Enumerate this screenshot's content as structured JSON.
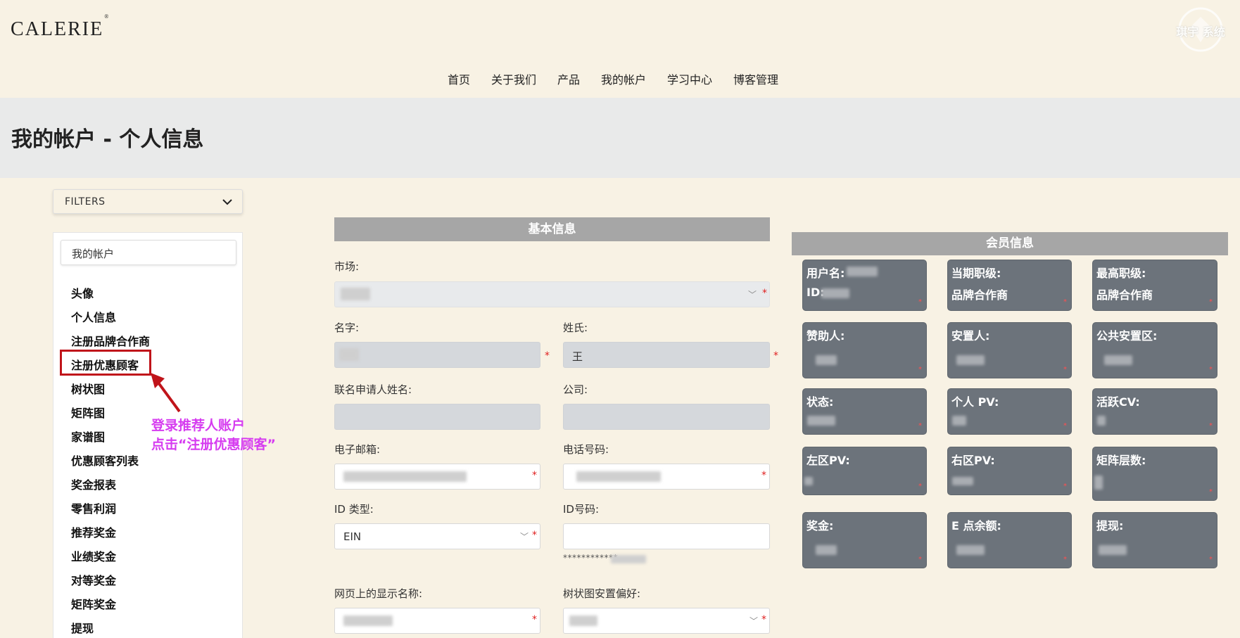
{
  "header": {
    "logo": "CALERIE",
    "logo_mark": "®",
    "watermark_text": "琪宇 系统"
  },
  "nav": [
    "首页",
    "关于我们",
    "产品",
    "我的帐户",
    "学习中心",
    "博客管理"
  ],
  "page_title": "我的帐户 - 个人信息",
  "sidebar": {
    "filters_label": "FILTERS",
    "account_label": "我的帐户",
    "items": [
      "头像",
      "个人信息",
      "注册品牌合作商",
      "注册优惠顾客",
      "树状图",
      "矩阵图",
      "家谱图",
      "优惠顾客列表",
      "奖金报表",
      "零售利润",
      "推荐奖金",
      "业绩奖金",
      "对等奖金",
      "矩阵奖金",
      "提现"
    ],
    "highlighted_item": "注册优惠顾客"
  },
  "annotation": {
    "line1": "登录推荐人账户",
    "line2": "点击“注册优惠顾客”"
  },
  "basic_info": {
    "heading": "基本信息",
    "market_label": "市场:",
    "first_name_label": "名字:",
    "last_name_label": "姓氏:",
    "last_name_value": "王",
    "co_applicant_label": "联名申请人姓名:",
    "company_label": "公司:",
    "email_label": "电子邮箱:",
    "phone_label": "电话号码:",
    "id_type_label": "ID 类型:",
    "id_type_value": "EIN",
    "id_number_label": "ID号码:",
    "id_number_masked": "************",
    "display_name_label": "网页上的显示名称:",
    "tree_pref_label": "树状图安置偏好:",
    "required_mark": "*"
  },
  "member_info": {
    "heading": "会员信息",
    "cards": [
      {
        "label": "用户名:",
        "value": "ID:"
      },
      {
        "label": "当期职级:",
        "value": "品牌合作商"
      },
      {
        "label": "最高职级:",
        "value": "品牌合作商"
      },
      {
        "label": "赞助人:",
        "value": ""
      },
      {
        "label": "安置人:",
        "value": ""
      },
      {
        "label": "公共安置区:",
        "value": ""
      },
      {
        "label": "状态:",
        "value": ""
      },
      {
        "label": "个人 PV:",
        "value": ""
      },
      {
        "label": "活跃CV:",
        "value": ""
      },
      {
        "label": "左区PV:",
        "value": ""
      },
      {
        "label": "右区PV:",
        "value": ""
      },
      {
        "label": "矩阵层数:",
        "value": ""
      },
      {
        "label": "奖金:",
        "value": ""
      },
      {
        "label": "E 点余额:",
        "value": ""
      },
      {
        "label": "提现:",
        "value": ""
      }
    ]
  },
  "colors": {
    "background": "#f8f2e4",
    "title_band": "#e9eaea",
    "section_head": "#a6a6a6",
    "card": "#6c737b",
    "highlight": "#c0141a",
    "annotation": "#d63cf0",
    "required": "#e02020"
  }
}
